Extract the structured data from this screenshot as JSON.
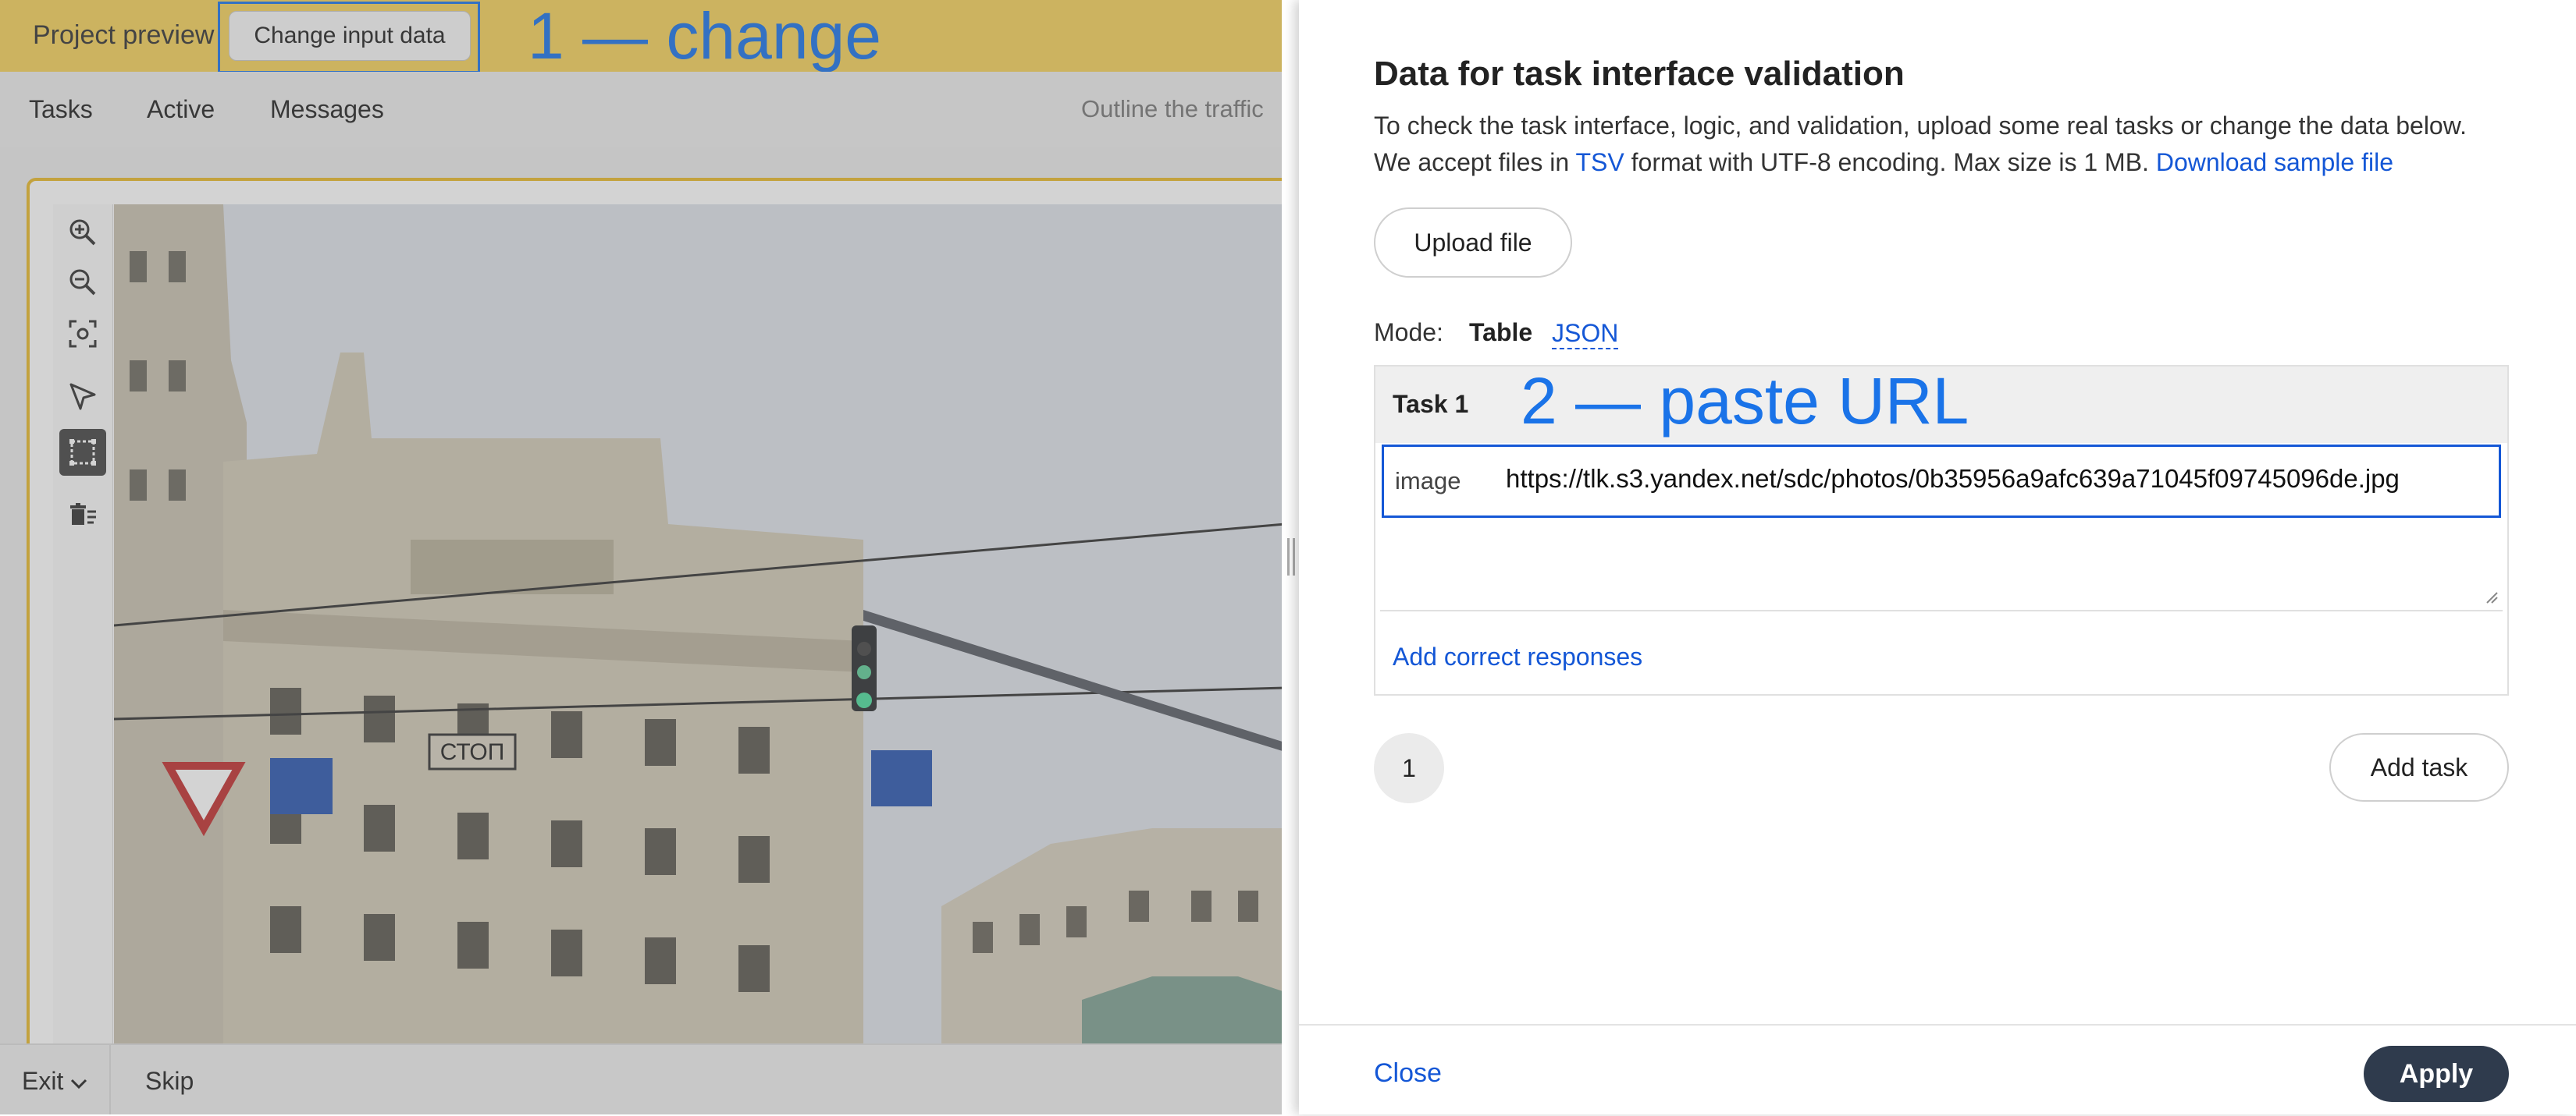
{
  "preview": {
    "project_label": "Project preview",
    "change_button": "Change input data",
    "annotation_1": "1 — change",
    "nav": [
      "Tasks",
      "Active",
      "Messages"
    ],
    "instruction_fragment": "Outline the traffic",
    "photo_sign_text": "СТОП",
    "tools": [
      "zoom-in-icon",
      "zoom-out-icon",
      "fit-to-screen-icon",
      "select-pointer-icon",
      "rectangle-tool-icon",
      "delete-all-icon"
    ],
    "footer": {
      "exit": "Exit",
      "skip": "Skip"
    }
  },
  "panel": {
    "title": "Data for task interface validation",
    "desc_line1": "To check the task interface, logic, and validation, upload some real tasks or change the data below.",
    "desc_line2_pre": "We accept files in ",
    "desc_tsv": "TSV",
    "desc_line2_post": " format with UTF-8 encoding. Max size is 1 MB. ",
    "desc_download": "Download sample file",
    "upload_button": "Upload file",
    "mode_label": "Mode:",
    "mode_table": "Table",
    "mode_json": "JSON",
    "task": {
      "title": "Task 1",
      "annotation_2": "2 — paste URL",
      "field_label": "image",
      "field_value": "https://tlk.s3.yandex.net/sdc/photos/0b35956a9afc639a71045f09745096de.jpg",
      "add_correct": "Add correct responses"
    },
    "page_number": "1",
    "add_task_button": "Add task",
    "close_button": "Close",
    "apply_button": "Apply"
  },
  "colors": {
    "accent": "#1457d6",
    "annotation": "#1a73e8",
    "topbar": "#f5d25b",
    "apply": "#2f3b4d"
  }
}
